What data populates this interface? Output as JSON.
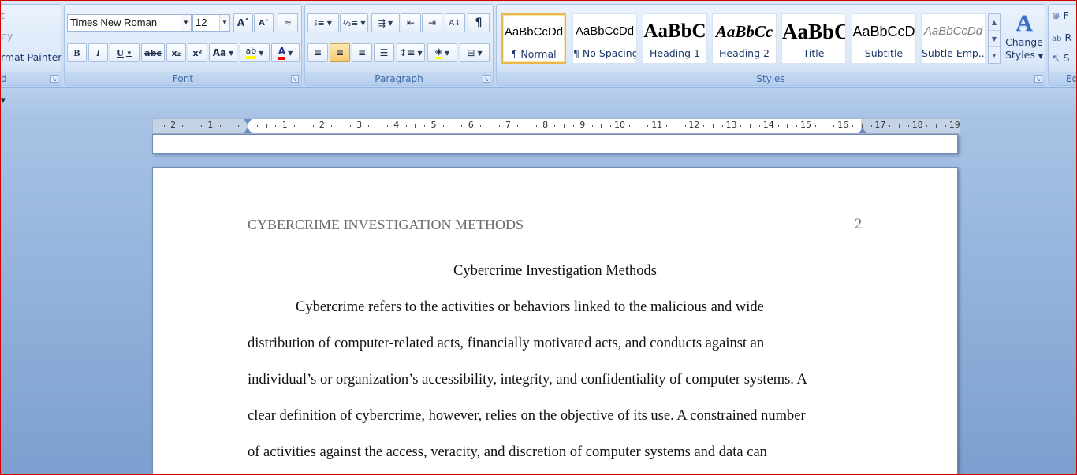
{
  "ribbon": {
    "clipboard": {
      "cut_label": "t",
      "copy_label": "py",
      "format_painter_label": "rmat Painter",
      "group_label": "d"
    },
    "font": {
      "font_name": "Times New Roman",
      "font_size": "12",
      "grow_glyph": "A˄",
      "shrink_glyph": "A˅",
      "clear_glyph": "≈",
      "bold_glyph": "B",
      "italic_glyph": "I",
      "underline_glyph": "U",
      "strike_glyph": "abc",
      "subscript_glyph": "x₂",
      "superscript_glyph": "x²",
      "case_glyph": "Aa",
      "highlight_glyph": "ab",
      "font_color_glyph": "A",
      "group_label": "Font"
    },
    "paragraph": {
      "group_label": "Paragraph",
      "sort_glyph": "A↓",
      "pilcrow_glyph": "¶"
    },
    "styles": {
      "group_label": "Styles",
      "tiles": [
        {
          "sample": "AaBbCcDd",
          "name": "¶ Normal"
        },
        {
          "sample": "AaBbCcDd",
          "name": "¶ No Spacing"
        },
        {
          "sample": "AaBbC",
          "name": "Heading 1"
        },
        {
          "sample": "AaBbCc",
          "name": "Heading 2"
        },
        {
          "sample": "AaBbC",
          "name": "Title"
        },
        {
          "sample": "AaBbCcD",
          "name": "Subtitle"
        },
        {
          "sample": "AaBbCcDd",
          "name": "Subtle Emp..."
        }
      ],
      "change_styles_line1": "Change",
      "change_styles_line2": "Styles"
    },
    "editing": {
      "find_label": "F",
      "replace_label": "R",
      "select_label": "S",
      "group_label": "Ed"
    }
  },
  "qat": {
    "arrow_glyph": "▾"
  },
  "ruler": {
    "numbers": [
      "2",
      "1",
      "1",
      "2",
      "3",
      "4",
      "5",
      "6",
      "7",
      "8",
      "9",
      "10",
      "11",
      "12",
      "13",
      "14",
      "15",
      "16",
      "17",
      "18",
      "19"
    ]
  },
  "document": {
    "running_head": "CYBERCRIME INVESTIGATION METHODS",
    "page_number": "2",
    "title": "Cybercrime Investigation Methods",
    "lines": [
      "Cybercrime refers to the activities or behaviors linked to the malicious and wide",
      "distribution of computer-related acts, financially motivated acts, and conducts against an",
      "individual’s or organization’s accessibility, integrity, and confidentiality of computer systems. A",
      "clear definition of cybercrime, however, relies on the objective of its use. A constrained number",
      "of activities against the access, veracity, and discretion of computer systems and data can"
    ]
  },
  "colors": {
    "ribbon_blue": "#cfdef3",
    "workspace_blue": "#7c9fcf",
    "selected_style": "#e9b84a",
    "font_color_bar": "#ff0000",
    "highlight_bar": "#ffff00"
  }
}
